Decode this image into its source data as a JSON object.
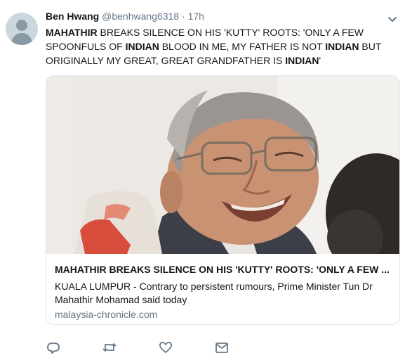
{
  "tweet": {
    "author_name": "Ben Hwang",
    "author_handle": "@benhwang6318",
    "separator": "·",
    "timestamp": "17h",
    "text_segments": [
      {
        "text": "MAHATHIR",
        "bold": true
      },
      {
        "text": " BREAKS SILENCE ON HIS 'KUTTY' ROOTS: 'ONLY A FEW SPOONFULS OF ",
        "bold": false
      },
      {
        "text": "INDIAN",
        "bold": true
      },
      {
        "text": " BLOOD IN ME, MY FATHER IS NOT ",
        "bold": false
      },
      {
        "text": "INDIAN",
        "bold": true
      },
      {
        "text": " BUT ORIGINALLY MY GREAT, GREAT GRANDFATHER IS ",
        "bold": false
      },
      {
        "text": "INDIAN",
        "bold": true
      },
      {
        "text": "'",
        "bold": false
      }
    ]
  },
  "card": {
    "title": "MAHATHIR BREAKS SILENCE ON HIS 'KUTTY' ROOTS: 'ONLY A FEW ...",
    "description": "KUALA LUMPUR - Contrary to persistent rumours, Prime Minister Tun Dr Mahathir Mohamad said today",
    "domain": "malaysia-chronicle.com"
  },
  "actions": {
    "icons": [
      "reply-icon",
      "retweet-icon",
      "like-icon",
      "direct-message-icon"
    ]
  },
  "colors": {
    "text": "#14171a",
    "secondary": "#657786",
    "border": "#e1e8ed",
    "icon": "#657786"
  }
}
